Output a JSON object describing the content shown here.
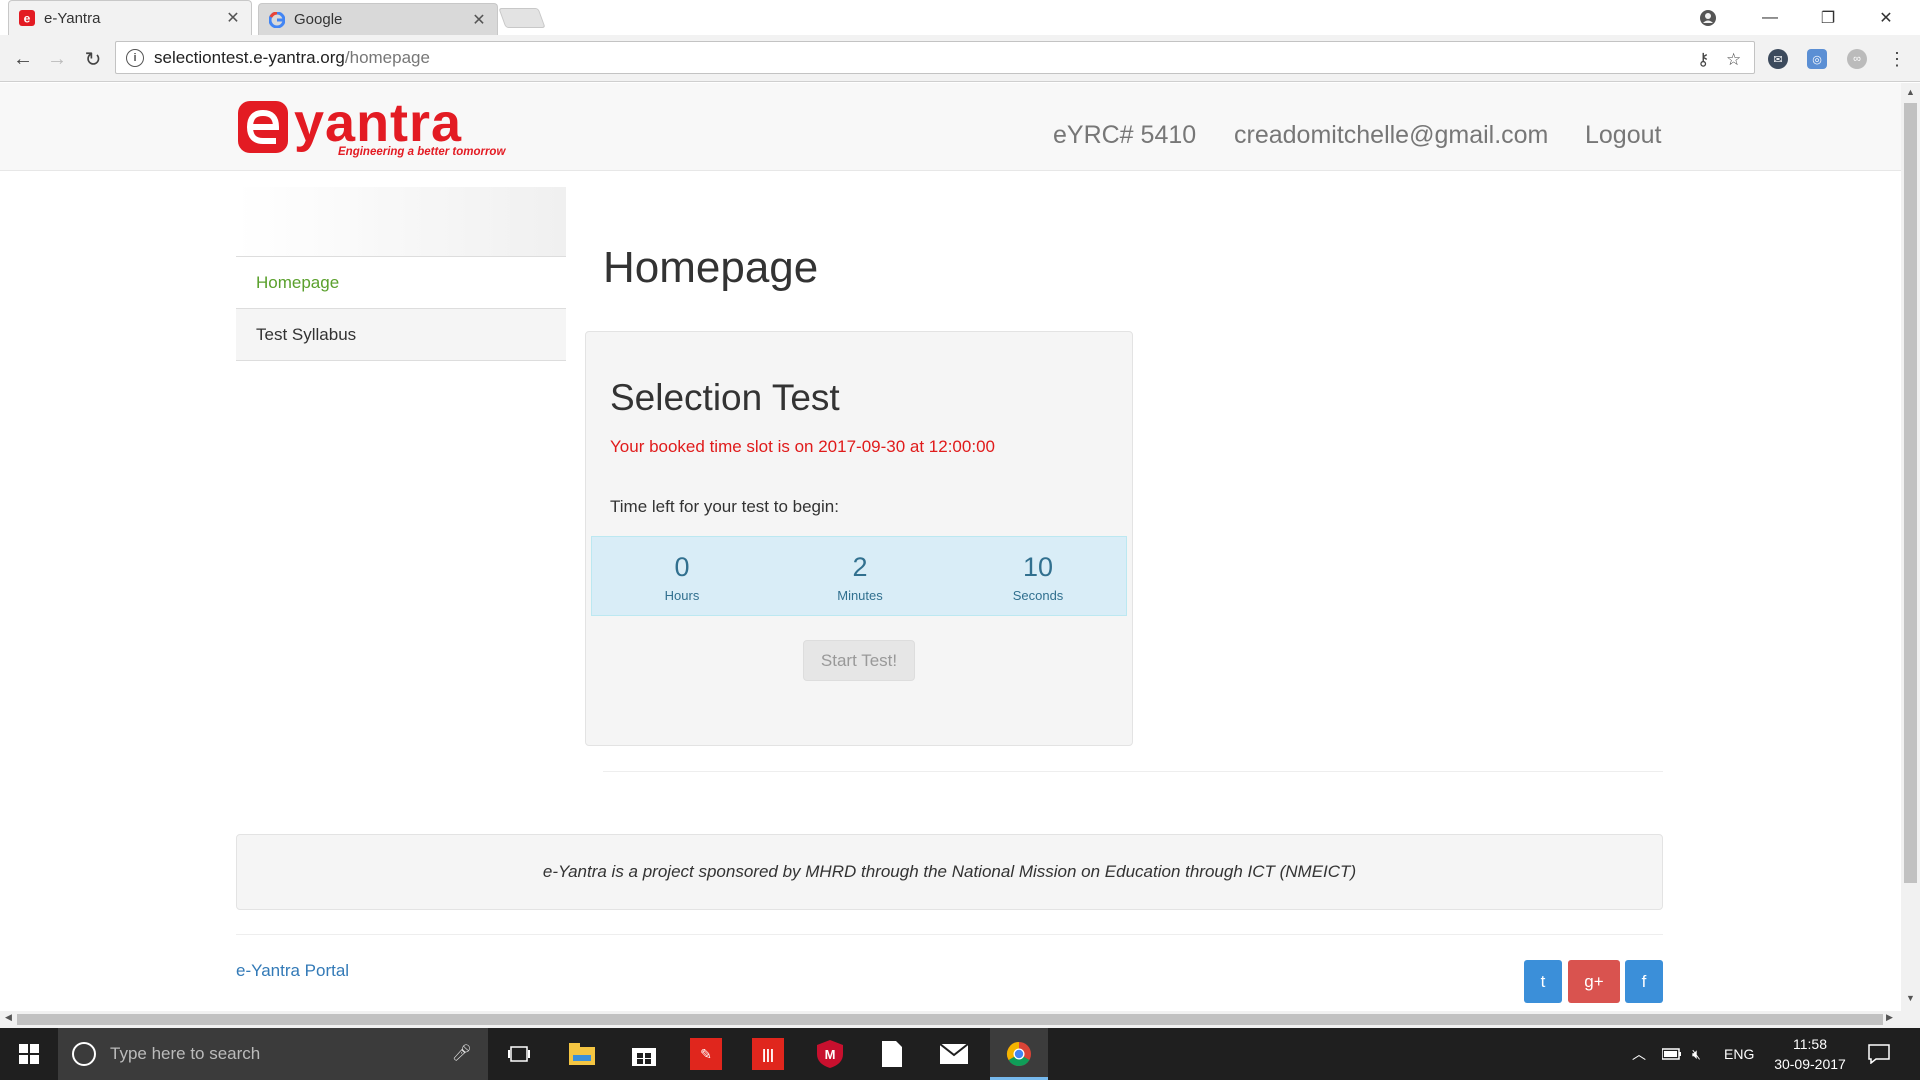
{
  "browser": {
    "tabs": [
      {
        "title": "e-Yantra",
        "active": true
      },
      {
        "title": "Google",
        "active": false
      }
    ],
    "url_host": "selectiontest.e-yantra.org",
    "url_path": "/homepage"
  },
  "site": {
    "logo_text": "eyantra",
    "logo_tagline": "Engineering a better tomorrow",
    "nav": {
      "team_id": "eYRC# 5410",
      "email": "creadomitchelle@gmail.com",
      "logout": "Logout"
    },
    "sidebar": [
      {
        "label": "Homepage",
        "active": true
      },
      {
        "label": "Test Syllabus",
        "active": false
      }
    ],
    "page_title": "Homepage",
    "test": {
      "heading": "Selection Test",
      "slot_message": "Your booked time slot is on 2017-09-30 at 12:00:00",
      "time_left_label": "Time left for your test to begin:",
      "countdown": [
        {
          "value": "0",
          "unit": "Hours"
        },
        {
          "value": "2",
          "unit": "Minutes"
        },
        {
          "value": "10",
          "unit": "Seconds"
        }
      ],
      "start_button": "Start Test!"
    },
    "sponsor_text": "e-Yantra is a project sponsored by MHRD through the National Mission on Education through ICT (NMEICT)",
    "portal_link": "e-Yantra Portal",
    "social": {
      "twitter": "t",
      "googleplus": "g+",
      "facebook": "f"
    },
    "colors": {
      "brand_red": "#e31b23",
      "active_green": "#5aa02c",
      "link_blue": "#337ab7",
      "alert_red": "#e01b1b"
    }
  },
  "taskbar": {
    "search_placeholder": "Type here to search",
    "language": "ENG",
    "time": "11:58",
    "date": "30-09-2017"
  }
}
